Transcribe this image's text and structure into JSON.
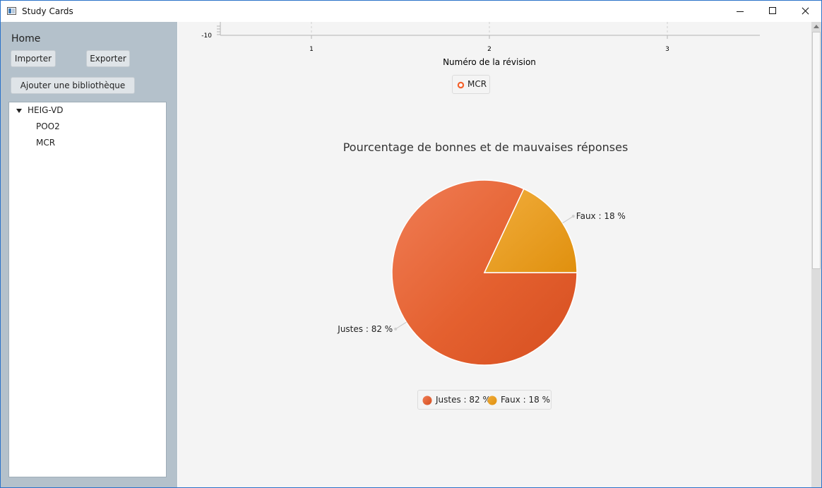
{
  "window": {
    "title": "Study Cards",
    "app_icon": "window-app-icon"
  },
  "sidebar": {
    "home_label": "Home",
    "import_label": "Importer",
    "export_label": "Exporter",
    "add_library_label": "Ajouter une bibliothèque",
    "tree": {
      "root": "HEIG-VD",
      "children": [
        "POO2",
        "MCR"
      ]
    }
  },
  "line_chart": {
    "y_tick_visible": "-10",
    "x_ticks": [
      "1",
      "2",
      "3"
    ],
    "xlabel": "Numéro de la révision",
    "legend": {
      "series": "MCR",
      "color": "#f3622d"
    }
  },
  "chart_data": {
    "type": "pie",
    "title": "Pourcentage de bonnes et de mauvaises réponses",
    "slices": [
      {
        "name": "Justes",
        "value": 82,
        "label": "Justes : 82 %",
        "color": "#e65b2e"
      },
      {
        "name": "Faux",
        "value": 18,
        "label": "Faux : 18 %",
        "color": "#eb9a26"
      }
    ],
    "legend": [
      "Justes : 82 %",
      "Faux : 18 %"
    ],
    "legend_position": "bottom"
  }
}
